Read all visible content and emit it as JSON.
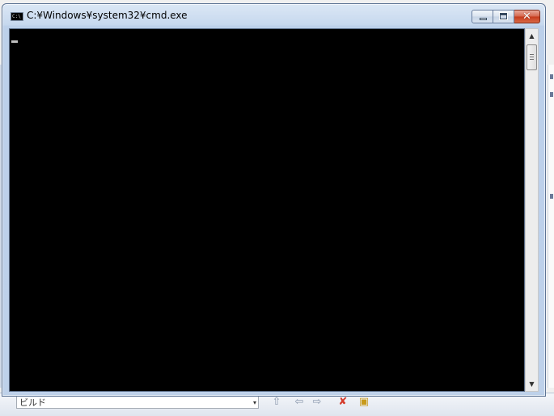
{
  "window": {
    "title": "C:¥Windows¥system32¥cmd.exe",
    "icon": "console-icon",
    "icon_text": "C:\\",
    "buttons": {
      "minimize_icon": "minimize-icon",
      "maximize_icon": "maximize-icon",
      "close_icon": "close-icon",
      "close_glyph": "✕"
    }
  },
  "console": {
    "background": "#000000",
    "cursor_color": "#c0c0c0"
  },
  "scrollbar": {
    "up_glyph": "▲",
    "down_glyph": "▼"
  },
  "background_toolbar": {
    "combo_value": "ビルド",
    "combo_arrow": "▾",
    "icons": [
      "arrow-icon",
      "undo-icon",
      "redo-icon",
      "delete-icon",
      "toolbox-icon"
    ],
    "icon_glyphs": [
      "⇧",
      "⇦",
      "⇨",
      "✘",
      "▣"
    ]
  }
}
